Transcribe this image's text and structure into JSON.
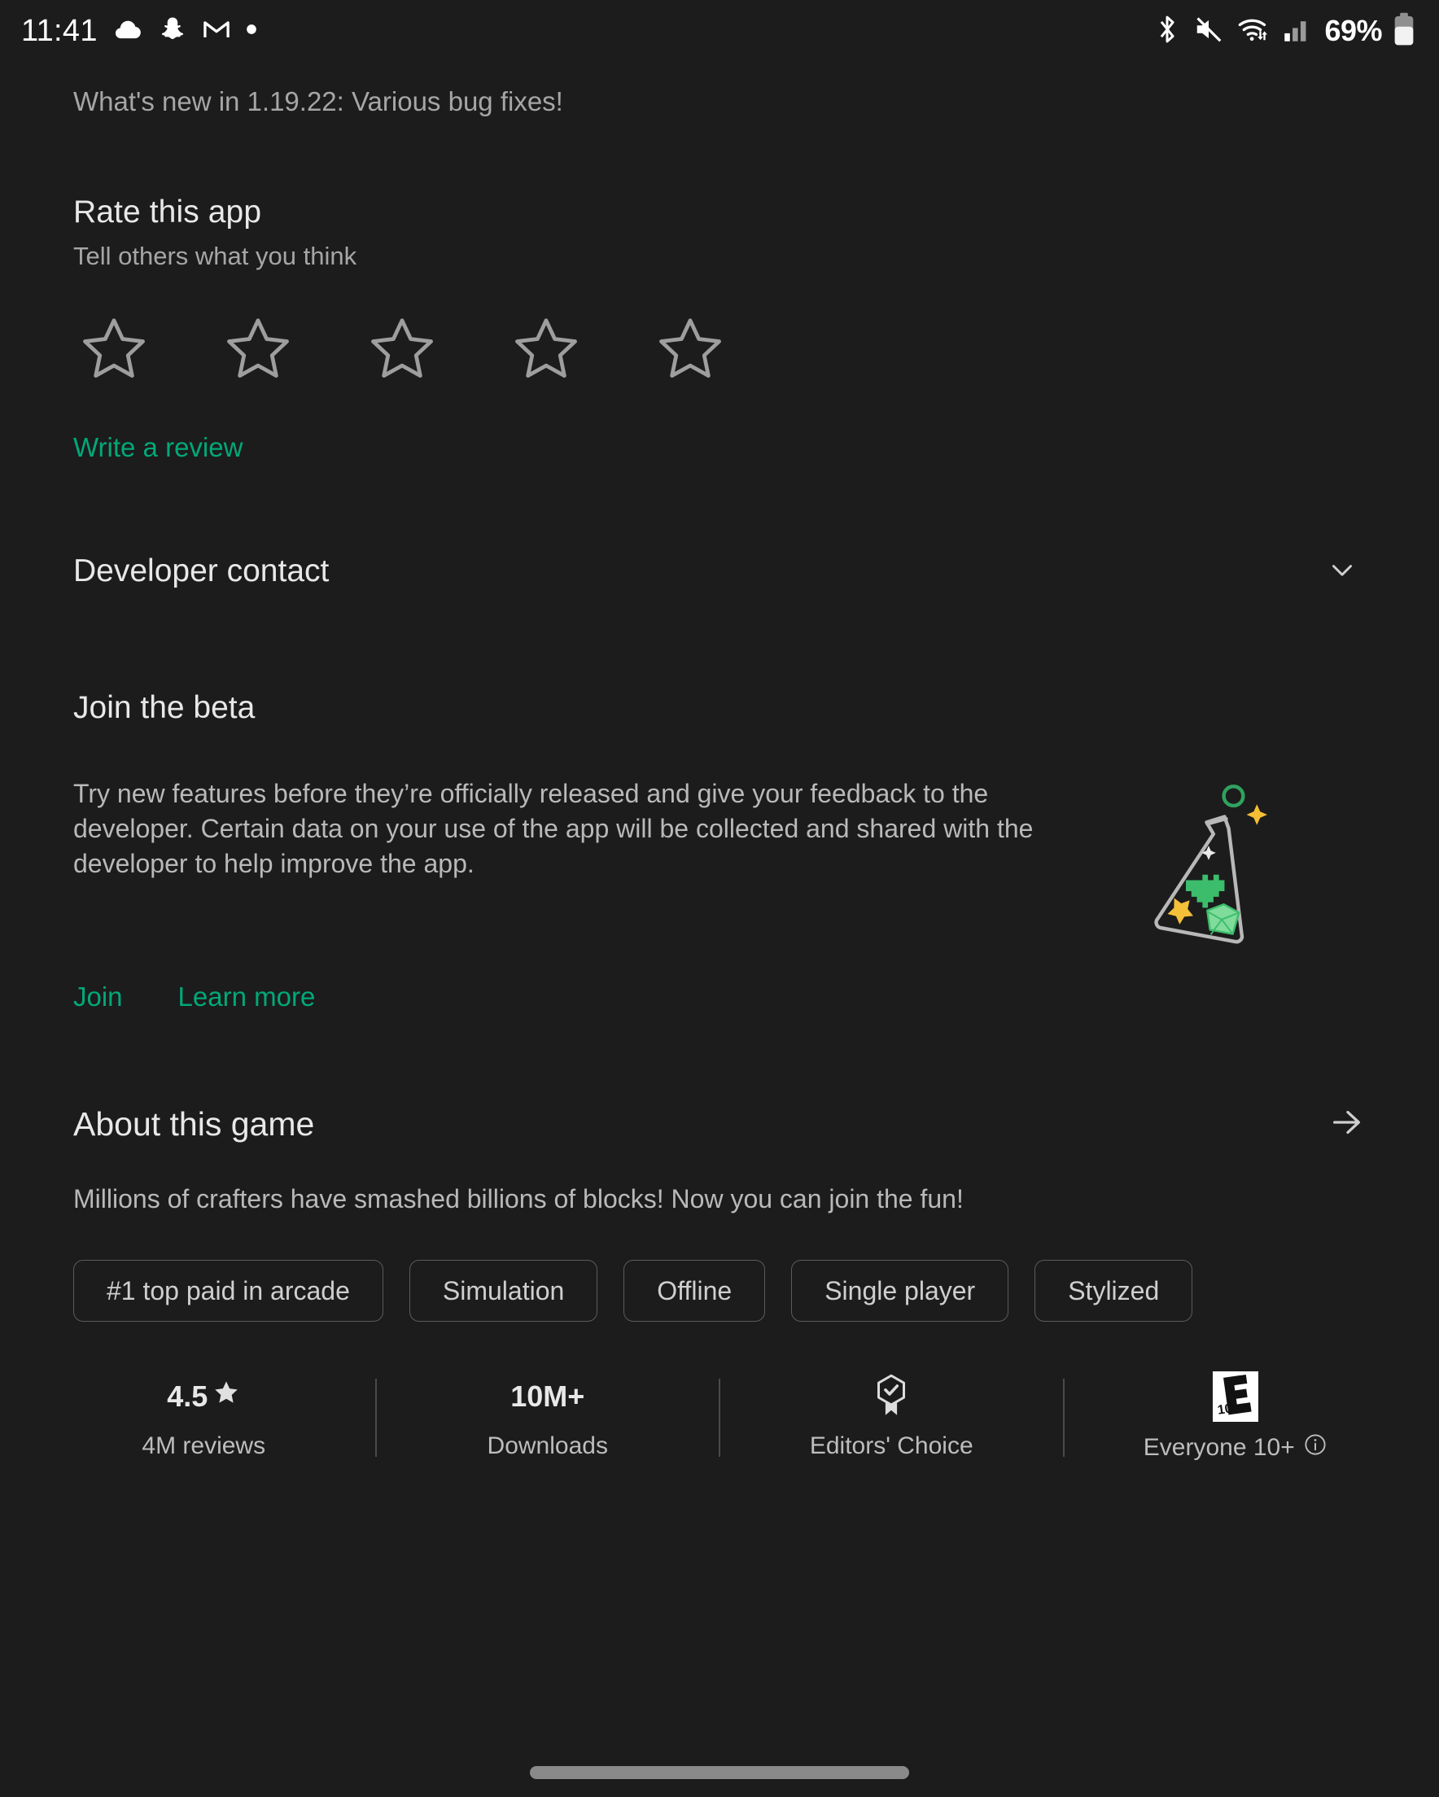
{
  "status_bar": {
    "time": "11:41",
    "left_icons": [
      "cloud-icon",
      "snapchat-icon",
      "gmail-icon",
      "dot-icon"
    ],
    "right_icons": [
      "bluetooth-icon",
      "volume-muted-icon",
      "wifi-icon",
      "cellular-signal-icon"
    ],
    "battery_percent": "69%"
  },
  "whats_new": {
    "text": "What's new in 1.19.22: Various bug fixes!"
  },
  "rate_app": {
    "title": "Rate this app",
    "subtitle": "Tell others what you think",
    "stars_total": 5,
    "stars_selected": 0,
    "write_review_label": "Write a review"
  },
  "developer_contact": {
    "title": "Developer contact",
    "expand_icon": "chevron-down-icon",
    "expanded": false
  },
  "join_beta": {
    "title": "Join the beta",
    "body": "Try new features before they’re officially released and give your feedback to the developer. Certain data on your use of the app will be collected and shared with the developer to help improve the app.",
    "join_label": "Join",
    "learn_more_label": "Learn more",
    "illustration": "beta-flask-icon"
  },
  "about_game": {
    "title": "About this game",
    "arrow_icon": "arrow-right-icon",
    "description": "Millions of crafters have smashed billions of blocks! Now you can join the fun!",
    "chips": [
      "#1 top paid in arcade",
      "Simulation",
      "Offline",
      "Single player",
      "Stylized"
    ]
  },
  "stats": [
    {
      "value": "4.5",
      "icon": "star-filled-icon",
      "label": "4M reviews"
    },
    {
      "value": "10M+",
      "icon": "",
      "label": "Downloads"
    },
    {
      "value": "",
      "icon": "editors-choice-icon",
      "label": "Editors' Choice"
    },
    {
      "value": "",
      "icon": "esrb-e10plus-icon",
      "esrb_rating": "E",
      "esrb_age": "10+",
      "label": "Everyone 10+",
      "info_icon": "info-icon"
    }
  ],
  "colors": {
    "background": "#1c1c1c",
    "accent_green": "#01a978",
    "primary_text": "#e8e8e8",
    "secondary_text": "#a6a6a6",
    "chip_border": "#5b5b5b",
    "star_yellow": "#f7c83e",
    "beta_green": "#3cb371"
  }
}
